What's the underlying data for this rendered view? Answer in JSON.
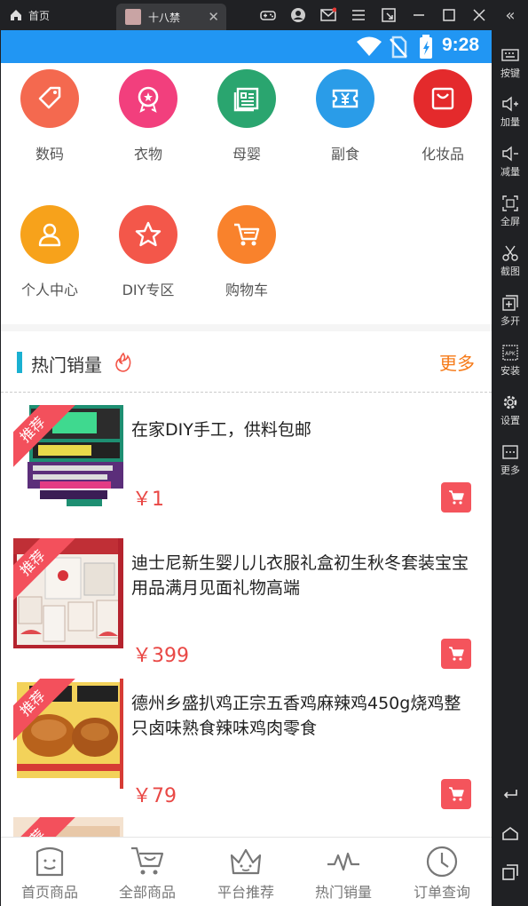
{
  "topbar": {
    "home_tab_label": "首页",
    "app_tab_label": "十八禁",
    "icons": [
      "gamepad-icon",
      "account-icon",
      "mail-icon",
      "menu-icon",
      "screenshot-icon",
      "minimize-icon",
      "maximize-icon",
      "close-icon"
    ]
  },
  "sidebar": {
    "items": [
      {
        "label": "按键",
        "icon": "keyboard-icon"
      },
      {
        "label": "加量",
        "icon": "volume-up-icon"
      },
      {
        "label": "减量",
        "icon": "volume-down-icon"
      },
      {
        "label": "全屏",
        "icon": "fullscreen-icon"
      },
      {
        "label": "截图",
        "icon": "scissors-icon"
      },
      {
        "label": "多开",
        "icon": "multi-instance-icon"
      },
      {
        "label": "安装",
        "icon": "apk-icon"
      },
      {
        "label": "设置",
        "icon": "gear-icon"
      },
      {
        "label": "更多",
        "icon": "more-icon"
      }
    ]
  },
  "statusbar": {
    "time": "9:28"
  },
  "categories": [
    {
      "label": "数码",
      "icon": "tag-icon",
      "color": "#f4694f"
    },
    {
      "label": "衣物",
      "icon": "badge-icon",
      "color": "#f23f7d"
    },
    {
      "label": "母婴",
      "icon": "document-icon",
      "color": "#2aa56f"
    },
    {
      "label": "副食",
      "icon": "ticket-icon",
      "color": "#2a9ce8"
    },
    {
      "label": "化妆品",
      "icon": "bag-icon",
      "color": "#e42a2c"
    },
    {
      "label": "个人中心",
      "icon": "user-icon",
      "color": "#f7a21b"
    },
    {
      "label": "DIY专区",
      "icon": "star-icon",
      "color": "#f3574a"
    },
    {
      "label": "购物车",
      "icon": "cart-icon",
      "color": "#f9822c"
    }
  ],
  "hot": {
    "title": "热门销量",
    "more": "更多"
  },
  "products": [
    {
      "badge": "推荐",
      "title": "在家DIY手工，供料包邮",
      "price": "￥1"
    },
    {
      "badge": "推荐",
      "title": "迪士尼新生婴儿儿衣服礼盒初生秋冬套装宝宝用品满月见面礼物高端",
      "price": "￥399"
    },
    {
      "badge": "推荐",
      "title": "德州乡盛扒鸡正宗五香鸡麻辣鸡450g烧鸡整只卤味熟食辣味鸡肉零食",
      "price": "￥79"
    },
    {
      "badge": "推荐",
      "title": "",
      "price": ""
    }
  ],
  "bottom_nav": [
    {
      "label": "首页商品",
      "icon": "home-box-icon"
    },
    {
      "label": "全部商品",
      "icon": "cart-icon"
    },
    {
      "label": "平台推荐",
      "icon": "crown-icon"
    },
    {
      "label": "热门销量",
      "icon": "pulse-icon"
    },
    {
      "label": "订单查询",
      "icon": "clock-icon"
    }
  ],
  "colors": {
    "statusbar": "#2196f3",
    "accent_red": "#e94845",
    "more_orange": "#f67a18",
    "hot_bar": "#1ab0d1"
  }
}
